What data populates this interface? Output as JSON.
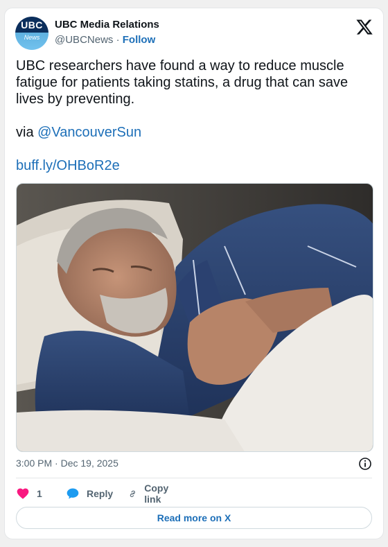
{
  "account": {
    "avatar_top": "UBC",
    "avatar_bottom": "News",
    "display_name": "UBC Media Relations",
    "handle": "@UBCNews",
    "separator": "·",
    "follow_label": "Follow"
  },
  "tweet": {
    "text": "UBC researchers have found a way to reduce muscle fatigue for patients taking statins, a drug that can save lives by preventing.",
    "via_prefix": "via ",
    "via_mention": "@VancouverSun",
    "short_link": "buff.ly/OHBoR2e"
  },
  "meta": {
    "timestamp": "3:00 PM · Dec 19, 2025"
  },
  "actions": {
    "like_count": "1",
    "reply_label": "Reply",
    "copy_link_label": "Copy link"
  },
  "footer": {
    "read_more_label": "Read more on X"
  },
  "colors": {
    "link": "#1d6fb8",
    "heart": "#f91880",
    "reply_bubble": "#1d9bf0"
  }
}
